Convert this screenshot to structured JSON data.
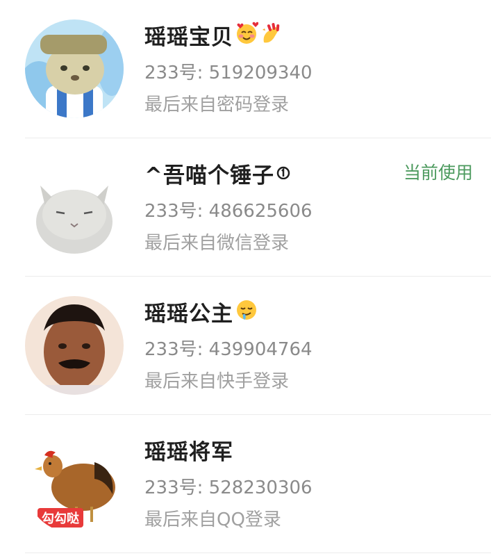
{
  "accounts": [
    {
      "nickname": "瑶瑶宝贝",
      "uid_text": "233号: 519209340",
      "login_source": "最后来自密码登录",
      "is_current": false,
      "emojis": [
        "smiling-face-with-hearts-icon",
        "nail-polish-icon"
      ]
    },
    {
      "nickname": "^吾喵个锤子",
      "uid_text": "233号: 486625606",
      "login_source": "最后来自微信登录",
      "is_current": true,
      "current_label": "当前使用",
      "emojis": [
        "circled-one-icon"
      ]
    },
    {
      "nickname": "瑶瑶公主",
      "uid_text": "233号: 439904764",
      "login_source": "最后来自快手登录",
      "is_current": false,
      "emojis": [
        "drooling-face-icon"
      ]
    },
    {
      "nickname": "瑶瑶将军",
      "uid_text": "233号: 528230306",
      "login_source": "最后来自QQ登录",
      "is_current": false,
      "emojis": [],
      "avatar_tag": "勾勾哒"
    }
  ],
  "colors": {
    "current_badge": "#4c9a5e",
    "nickname": "#1f1f1f",
    "uid": "#8a8a8a",
    "login_source": "#a0a0a0",
    "divider": "#ececec"
  }
}
